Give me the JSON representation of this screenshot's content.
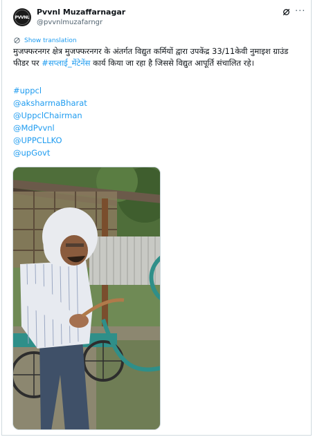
{
  "tweet": {
    "author_name": "Pvvnl Muzaffarnagar",
    "author_handle": "@pvvnlmuzafarngr",
    "avatar_text": "PVVNL",
    "translate_label": "Show translation",
    "text_before": "मुजफ्फरनगर क्षेत्र मुजफ्फरनगर के अंतर्गत विद्युत कर्मियों द्वारा उपकेंद्र 33/11केवी नुमाइश ग्राउंड फीडर पर ",
    "text_hashtag": "#सप्लाई_मेंटेनेंस",
    "text_after": " कार्य किया जा रहा है जिससे विद्युत आपूर्ति संचालित रहे।",
    "tags": [
      "#uppcl",
      "@aksharmaBharat",
      "@UppclChairman",
      "@MdPvvnl",
      "@UPPCLLKO",
      "@upGovt"
    ]
  },
  "colors": {
    "link": "#1d9bf0",
    "text": "#0f1419",
    "secondary": "#536471",
    "border": "#cfd9de"
  },
  "icons": {
    "grok": "grok-icon",
    "more": "more-icon",
    "translate": "globe-icon"
  }
}
